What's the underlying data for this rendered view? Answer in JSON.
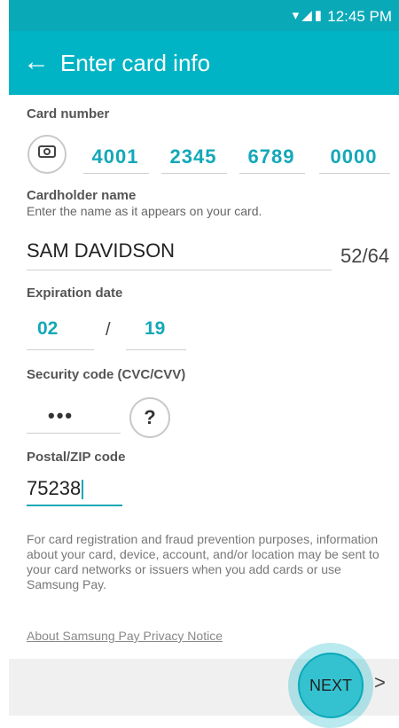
{
  "status_bar": {
    "time": "12:45 PM",
    "icons": [
      "wifi-icon",
      "signal-icon",
      "battery-icon"
    ]
  },
  "app_bar": {
    "title": "Enter card info",
    "back_icon": "arrow-left-icon"
  },
  "card_number": {
    "label": "Card number",
    "groups": [
      "4001",
      "2345",
      "6789",
      "0000"
    ]
  },
  "cardholder": {
    "label": "Cardholder name",
    "hint": "Enter the name as it appears on your card.",
    "value": "SAM DAVIDSON",
    "counter": "52/64"
  },
  "expiration": {
    "label": "Expiration date",
    "month": "02",
    "separator": "/",
    "year": "19"
  },
  "security_code": {
    "label": "Security code (CVC/CVV)",
    "value": "•••",
    "help": "?"
  },
  "postal": {
    "label": "Postal/ZIP code",
    "value": "75238"
  },
  "disclaimer": "For card registration and fraud prevention purposes, information about your card, device, account, and/or location may be sent to your card networks or issuers when you add cards or use Samsung Pay.",
  "privacy_link": "About Samsung Pay Privacy Notice",
  "footer": {
    "next_label": "NEXT",
    "chevron": ">"
  },
  "colors": {
    "accent": "#00b4c5",
    "field_text": "#13a8b8"
  }
}
